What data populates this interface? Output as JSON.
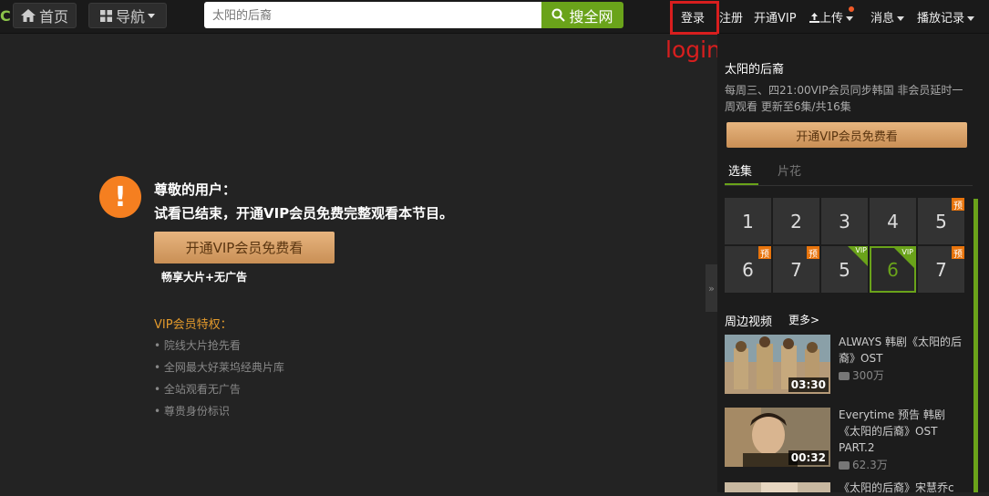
{
  "topbar": {
    "logo_fragment": "C",
    "home_label": "首页",
    "nav_label": "导航",
    "search_placeholder": "太阳的后裔",
    "search_button": "搜全网",
    "links": {
      "login": "登录",
      "register": "注册",
      "vip": "开通VIP",
      "upload": "上传",
      "messages": "消息",
      "history": "播放记录"
    },
    "annotation": "login"
  },
  "notice": {
    "line1": "尊敬的用户：",
    "line2": "试看已结束，开通VIP会员免费完整观看本节目。",
    "vip_button": "开通VIP会员免费看",
    "vip_sub": "畅享大片+无广告",
    "privileges_title": "VIP会员特权：",
    "privileges": [
      "院线大片抢先看",
      "全网最大好莱坞经典片库",
      "全站观看无广告",
      "尊贵身份标识"
    ]
  },
  "sidebar": {
    "collapse_icon": "»",
    "title": "太阳的后裔",
    "description": "每周三、四21:00VIP会员同步韩国 非会员延时一周观看 更新至6集/共16集",
    "vip_button": "开通VIP会员免费看",
    "tabs": [
      "选集",
      "片花"
    ],
    "episodes_row1": [
      {
        "num": "1",
        "badge": ""
      },
      {
        "num": "2",
        "badge": ""
      },
      {
        "num": "3",
        "badge": ""
      },
      {
        "num": "4",
        "badge": ""
      },
      {
        "num": "5",
        "badge": "预"
      }
    ],
    "episodes_row2": [
      {
        "num": "6",
        "badge": "预"
      },
      {
        "num": "7",
        "badge": "预"
      },
      {
        "num": "5",
        "badge": "VIP"
      },
      {
        "num": "6",
        "badge": "VIP",
        "active": true
      },
      {
        "num": "7",
        "badge": "预"
      }
    ],
    "around_title": "周边视频",
    "more": "更多>",
    "videos": [
      {
        "title": "ALWAYS 韩剧《太阳的后裔》OST",
        "views": "300万",
        "duration": "03:30"
      },
      {
        "title": "Everytime 预告 韩剧《太阳的后裔》OST PART.2",
        "views": "62.3万",
        "duration": "00:32"
      },
      {
        "title": "《太阳的后裔》宋慧乔c",
        "views": "",
        "duration": ""
      }
    ]
  },
  "colors": {
    "accent_green": "#6aa31a",
    "vip_gold": "#d9a36b",
    "annotation_red": "#d81e1e",
    "warning_orange": "#f57f20"
  }
}
